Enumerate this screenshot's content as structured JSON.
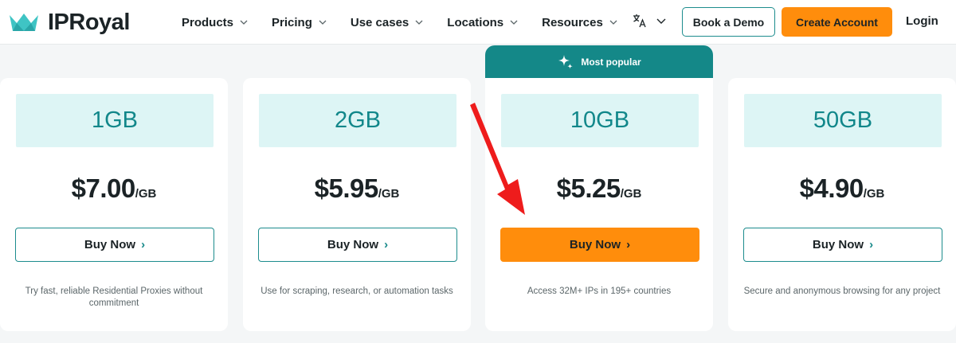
{
  "header": {
    "logo_text": "IPRoyal",
    "nav": [
      {
        "label": "Products"
      },
      {
        "label": "Pricing"
      },
      {
        "label": "Use cases"
      },
      {
        "label": "Locations"
      },
      {
        "label": "Resources"
      }
    ],
    "book_demo_label": "Book a Demo",
    "create_account_label": "Create Account",
    "login_label": "Login"
  },
  "badge": {
    "label": "Most popular"
  },
  "plans": [
    {
      "size": "1GB",
      "price": "$7.00",
      "unit": "/GB",
      "buy_label": "Buy Now",
      "description": "Try fast, reliable Residential Proxies without commitment"
    },
    {
      "size": "2GB",
      "price": "$5.95",
      "unit": "/GB",
      "buy_label": "Buy Now",
      "description": "Use for scraping, research, or automation tasks"
    },
    {
      "size": "10GB",
      "price": "$5.25",
      "unit": "/GB",
      "buy_label": "Buy Now",
      "description": "Access 32M+ IPs in 195+ countries"
    },
    {
      "size": "50GB",
      "price": "$4.90",
      "unit": "/GB",
      "buy_label": "Buy Now",
      "description": "Secure and anonymous browsing for any project"
    }
  ],
  "icons": {
    "logo": "crown-icon",
    "chevron": "chevron-down-icon",
    "language": "translate-icon",
    "badge": "sparkle-icon",
    "buy": "chevron-right-icon",
    "annotation": "red-arrow-icon"
  },
  "colors": {
    "brand_teal": "#148888",
    "accent_orange": "#ff8d0c",
    "size_tile": "#ddf5f5",
    "annotation_red": "#ee1c1c"
  }
}
